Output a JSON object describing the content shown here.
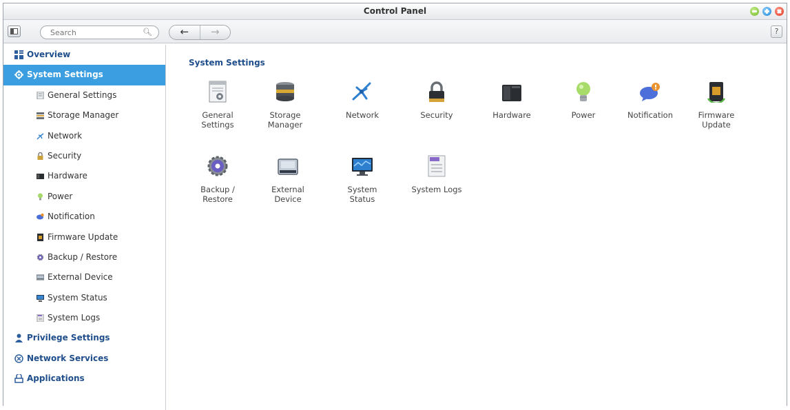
{
  "window": {
    "title": "Control Panel"
  },
  "toolbar": {
    "search_placeholder": "Search",
    "back": "←",
    "forward": "→",
    "help": "?"
  },
  "sidebar": {
    "overview": "Overview",
    "system_settings": "System Settings",
    "sub_items": [
      "General Settings",
      "Storage Manager",
      "Network",
      "Security",
      "Hardware",
      "Power",
      "Notification",
      "Firmware Update",
      "Backup / Restore",
      "External Device",
      "System Status",
      "System Logs"
    ],
    "privilege_settings": "Privilege Settings",
    "network_services": "Network Services",
    "applications": "Applications"
  },
  "main": {
    "heading": "System Settings",
    "tiles": [
      {
        "label": "General\nSettings",
        "icon": "general-settings-icon"
      },
      {
        "label": "Storage\nManager",
        "icon": "storage-manager-icon"
      },
      {
        "label": "Network",
        "icon": "network-icon"
      },
      {
        "label": "Security",
        "icon": "security-lock-icon"
      },
      {
        "label": "Hardware",
        "icon": "hardware-icon"
      },
      {
        "label": "Power",
        "icon": "power-bulb-icon"
      },
      {
        "label": "Notification",
        "icon": "notification-icon"
      },
      {
        "label": "Firmware\nUpdate",
        "icon": "firmware-update-icon"
      },
      {
        "label": "Backup /\nRestore",
        "icon": "backup-restore-icon"
      },
      {
        "label": "External\nDevice",
        "icon": "external-device-icon"
      },
      {
        "label": "System\nStatus",
        "icon": "system-status-icon"
      },
      {
        "label": "System Logs",
        "icon": "system-logs-icon"
      }
    ]
  },
  "colors": {
    "accent": "#3a9ee0",
    "heading": "#1f4e8c"
  }
}
